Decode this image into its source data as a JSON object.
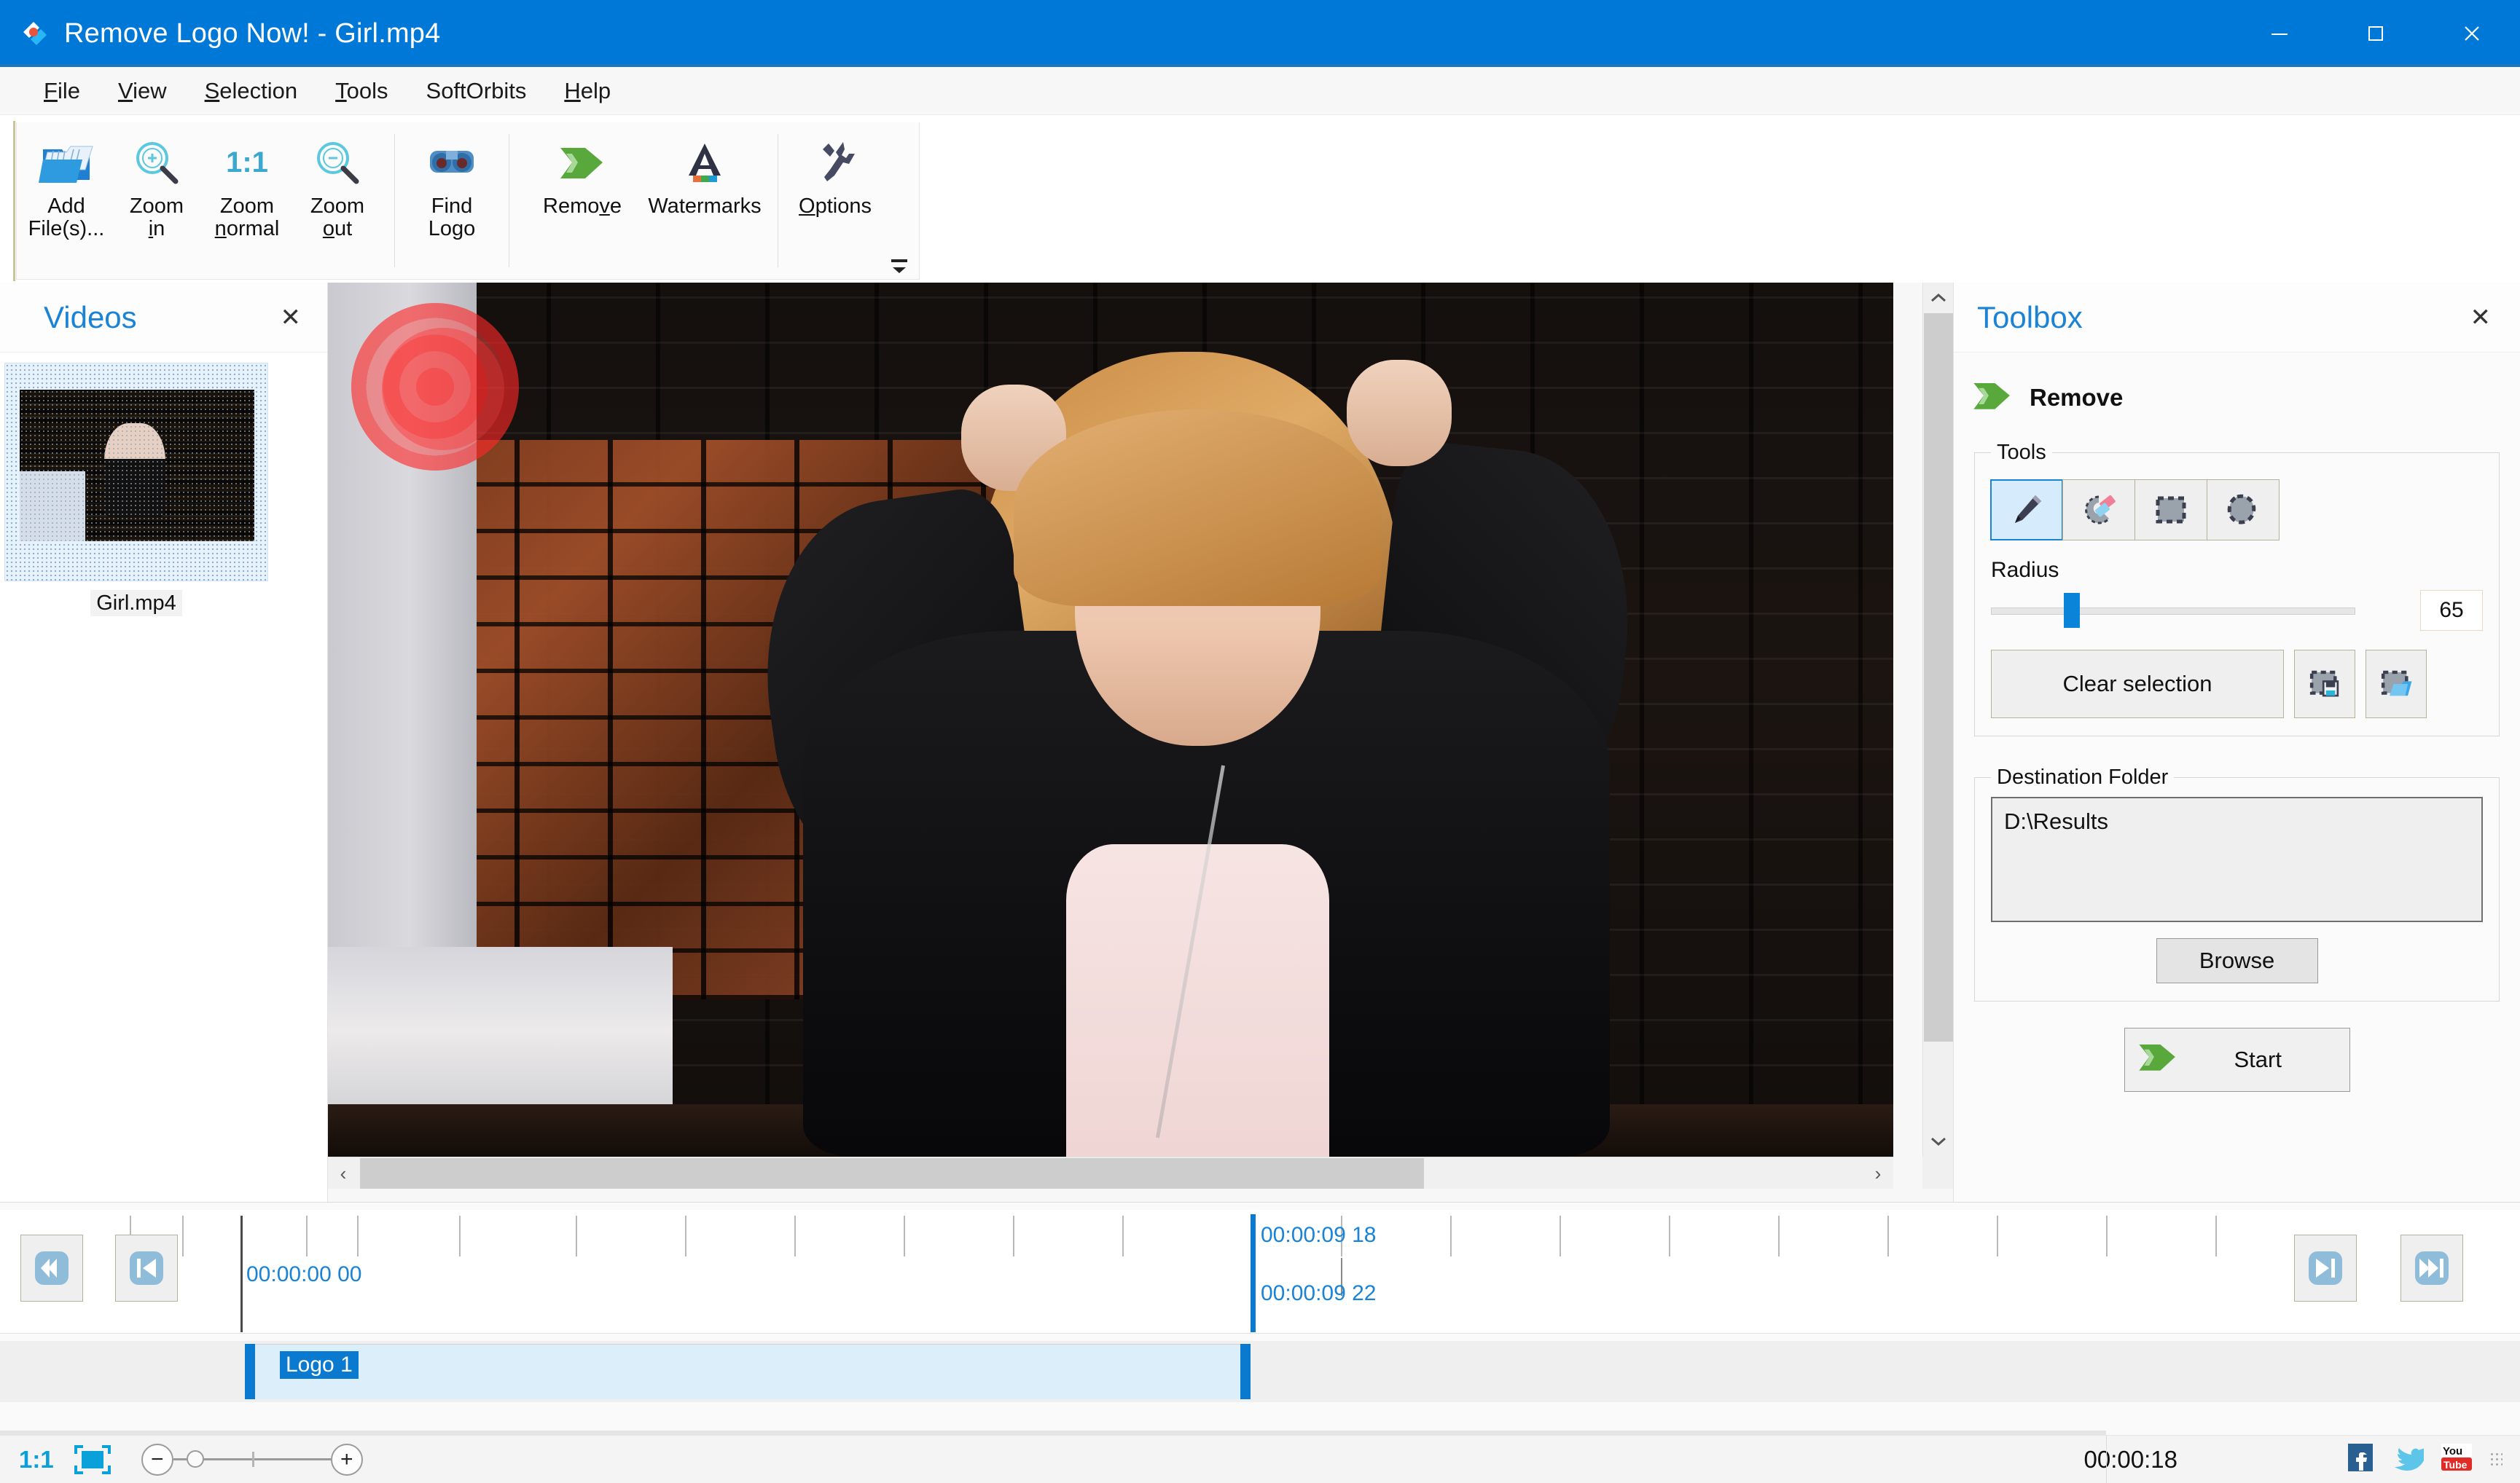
{
  "window": {
    "title": "Remove Logo Now! - Girl.mp4",
    "app_icon": "app-logo-icon",
    "minimize_label": "Minimize",
    "maximize_label": "Maximize",
    "close_label": "Close",
    "titlebar_color": "#0078d7"
  },
  "menubar": {
    "items": [
      {
        "label": "File",
        "accel": "F"
      },
      {
        "label": "View",
        "accel": "V"
      },
      {
        "label": "Selection",
        "accel": "S"
      },
      {
        "label": "Tools",
        "accel": "T"
      },
      {
        "label": "SoftOrbits",
        "accel": ""
      },
      {
        "label": "Help",
        "accel": "H"
      }
    ]
  },
  "ribbon": {
    "buttons": [
      {
        "label_line1": "Add",
        "label_line2": "File(s)...",
        "icon": "add-files-icon"
      },
      {
        "label_line1": "Zoom",
        "label_line2": "in",
        "icon": "zoom-in-icon"
      },
      {
        "label_line1": "Zoom",
        "label_line2": "normal",
        "icon": "zoom-normal-icon",
        "icon_text": "1:1"
      },
      {
        "label_line1": "Zoom",
        "label_line2": "out",
        "icon": "zoom-out-icon"
      },
      {
        "label_line1": "Find",
        "label_line2": "Logo",
        "icon": "find-logo-icon"
      },
      {
        "label_line1": "Remove",
        "label_line2": "",
        "icon": "remove-arrow-icon"
      },
      {
        "label_line1": "Watermarks",
        "label_line2": "",
        "icon": "watermarks-icon"
      },
      {
        "label_line1": "Options",
        "label_line2": "",
        "icon": "wrench-icon"
      }
    ],
    "expand_label": "▼"
  },
  "videos_panel": {
    "title": "Videos",
    "close_label": "✕",
    "items": [
      {
        "name": "Girl.mp4"
      }
    ]
  },
  "preview": {
    "scroll_left_label": "‹",
    "scroll_right_label": "›",
    "scroll_up_label": "⌃",
    "scroll_down_label": "⌄"
  },
  "toolbox": {
    "title": "Toolbox",
    "close_label": "✕",
    "mode_label": "Remove",
    "mode_icon": "green-arrow-icon",
    "tools_group_label": "Tools",
    "tools": [
      {
        "name": "pencil-tool",
        "selected": true
      },
      {
        "name": "eraser-tool",
        "selected": false
      },
      {
        "name": "rectangle-select-tool",
        "selected": false
      },
      {
        "name": "lasso-select-tool",
        "selected": false
      }
    ],
    "radius_label": "Radius",
    "radius_value": "65",
    "radius_min": "0",
    "radius_max": "255",
    "clear_selection_label": "Clear selection",
    "save_selection_icon": "save-selection-icon",
    "load_selection_icon": "load-selection-icon",
    "destination_group_label": "Destination Folder",
    "destination_value": "D:\\Results",
    "destination_placeholder": "Destination folder",
    "browse_label": "Browse",
    "start_label": "Start"
  },
  "timeline": {
    "nav_first_label": "⏮",
    "nav_prev_label": "⏪",
    "nav_next_label": "⏩",
    "nav_last_label": "⏭",
    "start_timecode": "00:00:00 00",
    "playhead_timecode_upper": "00:00:09 18",
    "playhead_timecode_lower": "00:00:09 22",
    "clip_label": "Logo 1"
  },
  "statusbar": {
    "zoom_ratio": "1:1",
    "fit_icon": "fit-to-window-icon",
    "zoom_out_label": "−",
    "zoom_in_label": "+",
    "total_duration": "00:00:18",
    "social": [
      {
        "name": "facebook-icon"
      },
      {
        "name": "twitter-icon"
      },
      {
        "name": "youtube-icon"
      }
    ]
  },
  "colors": {
    "accent": "#0078d7",
    "panel_title": "#1a83d6",
    "timecode": "#1a83d6",
    "brush_mark": "#ff2d2d",
    "green": "#5faa3c"
  }
}
